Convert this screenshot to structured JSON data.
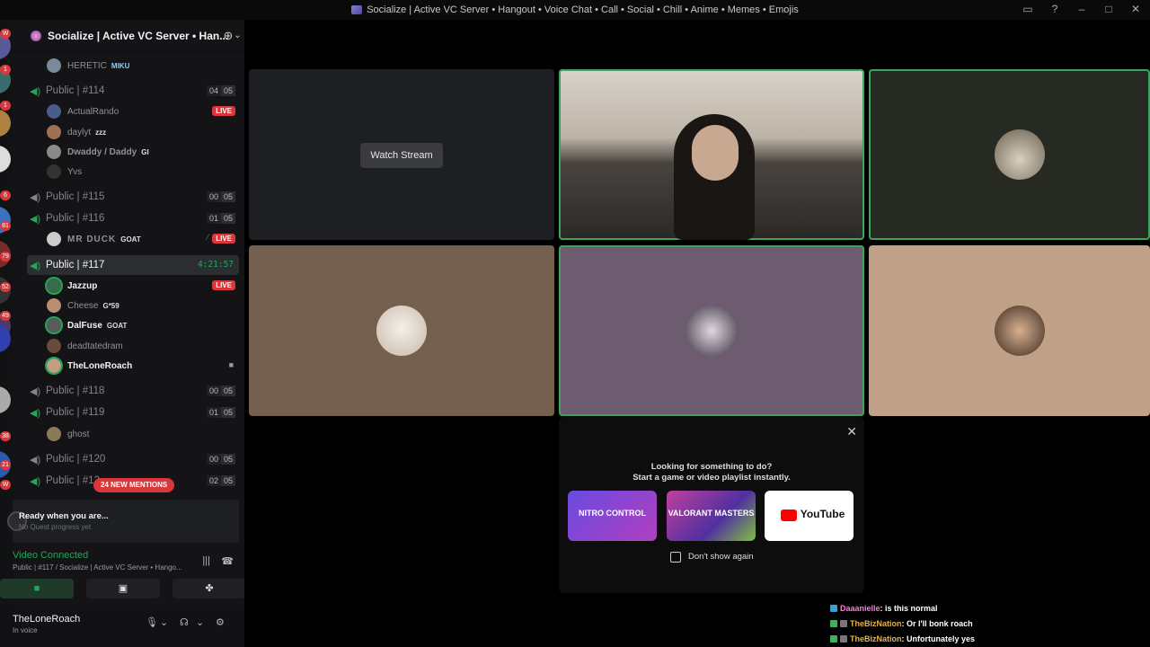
{
  "window": {
    "title": "Socialize | Active VC Server • Hangout • Voice Chat • Call • Social • Chill • Anime • Memes • Emojis"
  },
  "server": {
    "name": "Socialize | Active VC Server • Han..."
  },
  "rail_badges": [
    "W",
    "1",
    "1",
    "6",
    "81",
    "79",
    "52",
    "49",
    "38",
    "21",
    "W"
  ],
  "channels": [
    {
      "name": "HERETIC",
      "tag": "MIKU",
      "kind": "user"
    },
    {
      "name": "Public | #114",
      "c1": "04",
      "c2": "05"
    },
    {
      "name": "Public | #115",
      "c1": "00",
      "c2": "05"
    },
    {
      "name": "Public | #116",
      "c1": "01",
      "c2": "05"
    },
    {
      "name": "Public | #117",
      "timer": "4:21:57"
    },
    {
      "name": "Public | #118",
      "c1": "00",
      "c2": "05"
    },
    {
      "name": "Public | #119",
      "c1": "01",
      "c2": "05"
    },
    {
      "name": "Public | #120",
      "c1": "00",
      "c2": "05"
    },
    {
      "name": "Public | #12",
      "c1": "02",
      "c2": "05"
    }
  ],
  "users": {
    "actualrando": "ActualRando",
    "daylyt": "daylyt",
    "daylyt_tag": "zzz",
    "daddy": "Dwaddy / Daddy",
    "daddy_tag": "GI",
    "yvs": "Yvs",
    "duck": "MR DUCK",
    "duck_tag": "GOAT",
    "jazzup": "Jazzup",
    "cheese": "Cheese",
    "cheese_tag": "G*59",
    "dalfuse": "DalFuse",
    "dalfuse_tag": "GOAT",
    "deadtated": "deadtatedram",
    "theloneroach": "TheLoneRoach",
    "ghost": "ghost"
  },
  "live_label": "LIVE",
  "mentions": "24 NEW MENTIONS",
  "quest": {
    "title": "Ready when you are...",
    "sub": "No Quest progress yet"
  },
  "voice": {
    "state": "Video Connected",
    "path": "Public | #117 / Socialize | Active VC Server • Hango..."
  },
  "me": {
    "name": "TheLoneRoach",
    "status": "In voice"
  },
  "stage": {
    "watch_label": "Watch Stream",
    "activity_line1": "Looking for something to do?",
    "activity_line2": "Start a game or video playlist instantly.",
    "cards": [
      "NITRO CONTROL",
      "VALORANT MASTERS",
      "YouTube"
    ],
    "dont_show": "Don't show again"
  },
  "chat": [
    {
      "user": "Daaanielle",
      "msg": " : is this normal",
      "color": "#ff7ad9"
    },
    {
      "user": "TheBizNation",
      "msg": " : Or I'll bonk roach",
      "color": "#e8b34a"
    },
    {
      "user": "TheBizNation",
      "msg": " : Unfortunately yes",
      "color": "#e8b34a"
    }
  ]
}
